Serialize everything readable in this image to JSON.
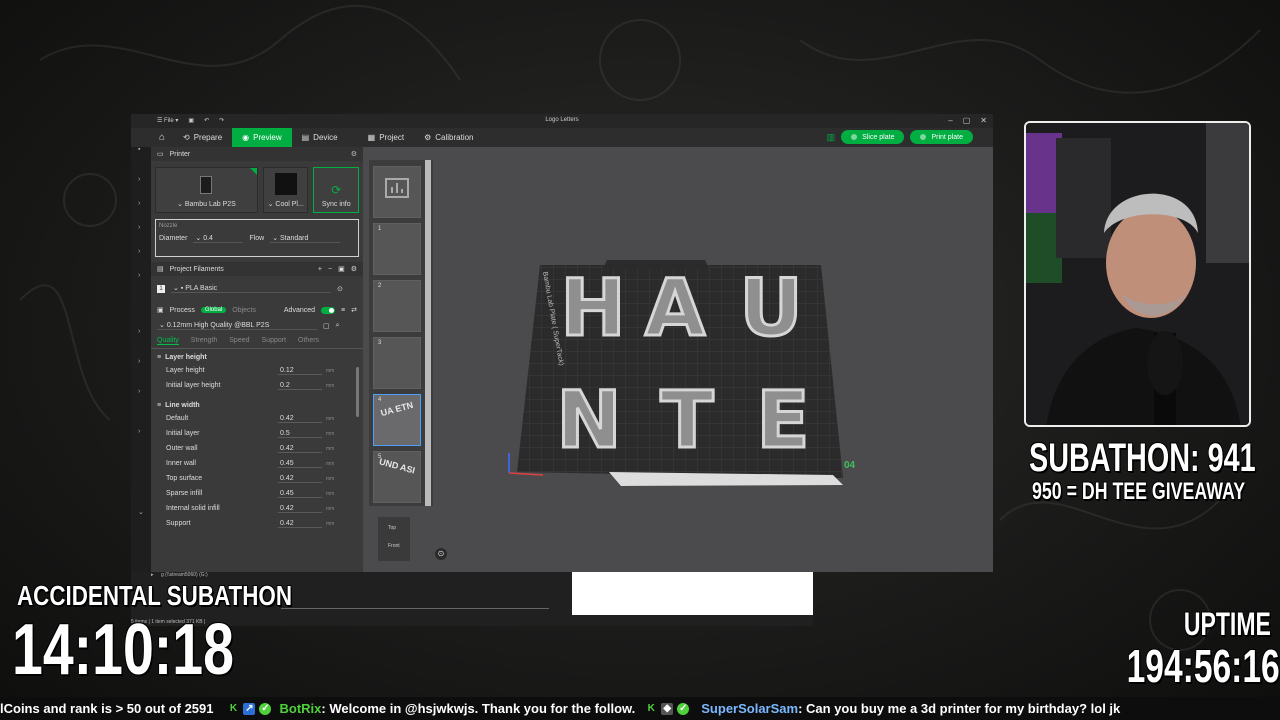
{
  "app": {
    "title": "Logo Letters",
    "file_menu": "File",
    "tabs": [
      {
        "label": "Prepare"
      },
      {
        "label": "Preview"
      },
      {
        "label": "Device"
      },
      {
        "label": "Project"
      },
      {
        "label": "Calibration"
      }
    ],
    "slice_button": "Slice plate",
    "print_button": "Print plate"
  },
  "printer": {
    "header": "Printer",
    "printer_name": "Bambu Lab P2S",
    "filament_short": "Cool Pl...",
    "sync_label": "Sync info",
    "nozzle_label": "Nozzle",
    "diameter_label": "Diameter",
    "diameter_value": "0.4",
    "flow_label": "Flow",
    "flow_value": "Standard"
  },
  "filaments": {
    "header": "Project Filaments",
    "items": [
      {
        "index": "1",
        "name": "PLA Basic"
      }
    ]
  },
  "process": {
    "header": "Process",
    "global_label": "Global",
    "objects_label": "Objects",
    "advanced_label": "Advanced",
    "preset": "0.12mm High Quality @BBL P2S",
    "tabs": [
      "Quality",
      "Strength",
      "Speed",
      "Support",
      "Others"
    ],
    "groups": [
      {
        "title": "Layer height",
        "params": [
          {
            "name": "Layer height",
            "value": "0.12",
            "unit": "mm"
          },
          {
            "name": "Initial layer height",
            "value": "0.2",
            "unit": "mm"
          }
        ]
      },
      {
        "title": "Line width",
        "params": [
          {
            "name": "Default",
            "value": "0.42",
            "unit": "mm"
          },
          {
            "name": "Initial layer",
            "value": "0.5",
            "unit": "mm"
          },
          {
            "name": "Outer wall",
            "value": "0.42",
            "unit": "mm"
          },
          {
            "name": "Inner wall",
            "value": "0.45",
            "unit": "mm"
          },
          {
            "name": "Top surface",
            "value": "0.42",
            "unit": "mm"
          },
          {
            "name": "Sparse infill",
            "value": "0.45",
            "unit": "mm"
          },
          {
            "name": "Internal solid infill",
            "value": "0.42",
            "unit": "mm"
          },
          {
            "name": "Support",
            "value": "0.42",
            "unit": "mm"
          }
        ]
      }
    ]
  },
  "plates": {
    "items": [
      "1",
      "2",
      "3",
      "4",
      "5"
    ],
    "plate_label": "Bambu Lab Plate ( SuperTack)",
    "plate_number": "04",
    "model_letters": [
      "H",
      "A",
      "U",
      "N",
      "T",
      "E"
    ],
    "thumb4_text": "UA ETN",
    "thumb5_text": "UND ASI"
  },
  "viewcube": {
    "top": "Top",
    "front": "Front"
  },
  "explorer": {
    "path_text": "g (\\\\stream5060) (G:)",
    "status_text": "5 items | 1 item selected 371 KB |"
  },
  "overlay": {
    "subathon_label": "SUBATHON: 941",
    "giveaway": "950 = DH TEE GIVEAWAY",
    "accidental": "ACCIDENTAL SUBATHON",
    "timer": "14:10:18",
    "uptime_label": "UPTIME",
    "uptime": "194:56:16"
  },
  "ticker": {
    "seg1": "lCoins and rank is > 50 out of 2591",
    "user1": "BotRix",
    "msg1": ": Welcome in @hsjwkwjs. Thank you for the follow.",
    "user2": "SuperSolarSam",
    "msg2": ": Can you buy me a 3d printer for my birthday? lol jk"
  },
  "colors": {
    "accent": "#00ae42",
    "ticker_user": "#4fd13c"
  }
}
